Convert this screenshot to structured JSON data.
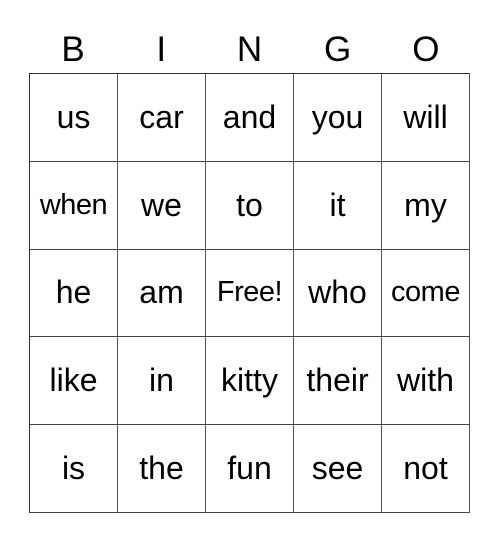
{
  "header": [
    "B",
    "I",
    "N",
    "G",
    "O"
  ],
  "rows": [
    [
      "us",
      "car",
      "and",
      "you",
      "will"
    ],
    [
      "when",
      "we",
      "to",
      "it",
      "my"
    ],
    [
      "he",
      "am",
      "Free!",
      "who",
      "come"
    ],
    [
      "like",
      "in",
      "kitty",
      "their",
      "with"
    ],
    [
      "is",
      "the",
      "fun",
      "see",
      "not"
    ]
  ]
}
